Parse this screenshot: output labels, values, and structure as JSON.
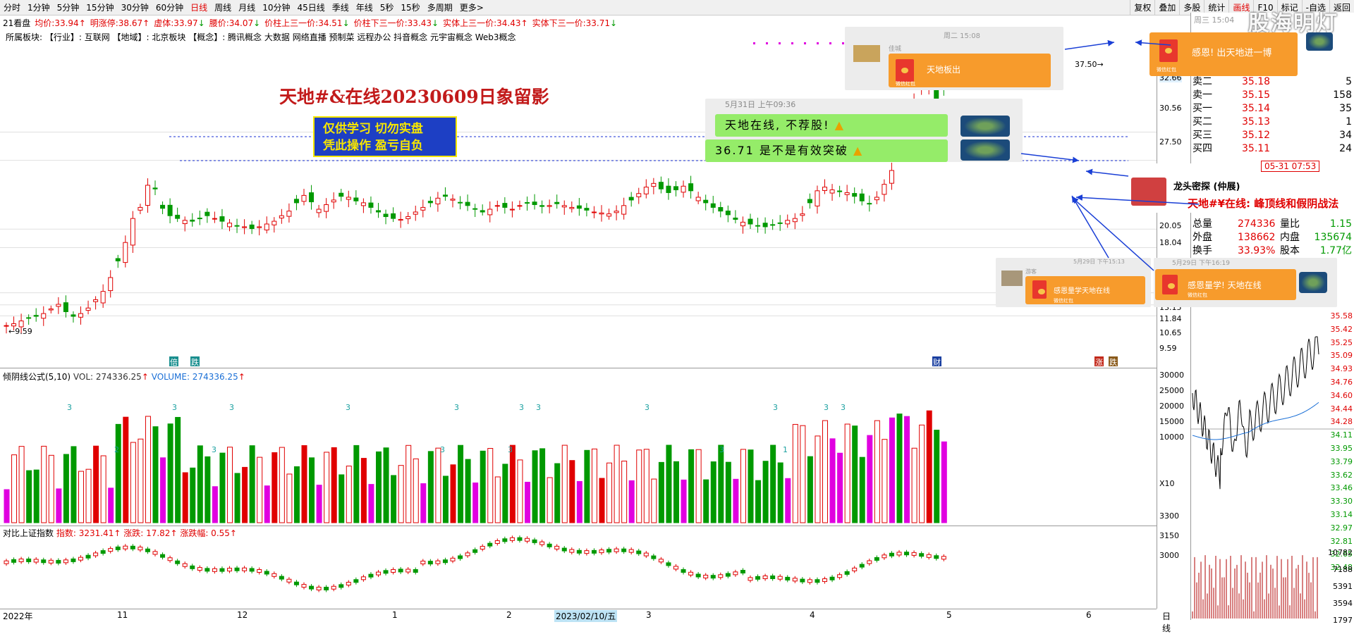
{
  "toolbar": {
    "left": [
      "分时",
      "1分钟",
      "5分钟",
      "15分钟",
      "30分钟",
      "60分钟",
      "日线",
      "周线",
      "月线",
      "10分钟",
      "45日线",
      "季线",
      "年线",
      "5秒",
      "15秒",
      "多周期",
      "更多>"
    ],
    "active": "日线",
    "right": [
      "复权",
      "叠加",
      "多股",
      "统计",
      "画线",
      "F10",
      "标记",
      "-自选",
      "返回"
    ],
    "right_active": "画线"
  },
  "quote": {
    "title": "21看盘",
    "items": [
      {
        "label": "均价:",
        "value": "33.94",
        "dir": "up"
      },
      {
        "label": "明涨停:",
        "value": "38.67",
        "dir": "up"
      },
      {
        "label": "虚体:",
        "value": "33.97",
        "dir": "dn"
      },
      {
        "label": "腰价:",
        "value": "34.07",
        "dir": "dn"
      },
      {
        "label": "价柱上三一价:",
        "value": "34.51",
        "dir": "dn"
      },
      {
        "label": "价柱下三一价:",
        "value": "33.43",
        "dir": "dn"
      },
      {
        "label": "实体上三一价:",
        "value": "34.43",
        "dir": "up"
      },
      {
        "label": "实体下三一价:",
        "value": "33.71",
        "dir": "dn"
      }
    ]
  },
  "concept": "所属板块:  【行业】: 互联网   【地域】: 北京板块   【概念】: 腾讯概念 大数据 网络直播 预制菜 远程办公 抖音概念 元宇宙概念 Web3概念",
  "headline": "天地#&在线20230609日象留影",
  "warning": [
    "仅供学习  切勿实盘",
    "凭此操作  盈亏自负"
  ],
  "watermark": "股海明灯",
  "indicators": {
    "volume_title": "倾阴线公式(5,10)",
    "vol_label": "VOL: 274336.25",
    "volume_label": "VOLUME: 274336.25",
    "index_title": "对比上证指数",
    "index_label": "指数: 3231.41",
    "change_label": "涨跌: 17.82",
    "pct_label": "涨跌幅: 0.55"
  },
  "price_marks": {
    "low": "9.59",
    "high": "37.50"
  },
  "dates": {
    "labels": [
      "2022年",
      "11",
      "12",
      "1",
      "2",
      "2023/02/10/五",
      "3",
      "4",
      "5",
      "6"
    ],
    "axis_label": "日线"
  },
  "main_scale": [
    "32.66",
    "30.56",
    "27.50",
    "20.05",
    "18.04",
    "13.15",
    "11.84",
    "10.65",
    "9.59"
  ],
  "vol_scale": [
    "30000",
    "25000",
    "20000",
    "15000",
    "10000",
    "X10"
  ],
  "idx_scale": [
    "3300",
    "3150",
    "3000"
  ],
  "orderbook": {
    "time": "周三 15:04",
    "rows": [
      {
        "n": "卖二",
        "p": "35.18",
        "q": "5"
      },
      {
        "n": "卖一",
        "p": "35.15",
        "q": "158"
      },
      {
        "n": "买一",
        "p": "35.14",
        "q": "35"
      },
      {
        "n": "买二",
        "p": "35.13",
        "q": "1"
      },
      {
        "n": "买三",
        "p": "35.12",
        "q": "34"
      },
      {
        "n": "买四",
        "p": "35.11",
        "q": "24"
      }
    ],
    "stats": [
      {
        "k": "总量",
        "v": "274336",
        "k2": "量比",
        "v2": "1.15"
      },
      {
        "k": "外盘",
        "v": "138662",
        "k2": "内盘",
        "v2": "135674"
      },
      {
        "k": "换手",
        "v": "33.93%",
        "k2": "股本",
        "v2": "1.77亿"
      }
    ],
    "tick_scale": [
      "35.58",
      "35.42",
      "35.25",
      "35.09",
      "34.93",
      "34.76",
      "34.60",
      "34.44",
      "34.28",
      "34.11",
      "33.95",
      "33.79",
      "33.62",
      "33.46",
      "33.30",
      "33.14",
      "32.97",
      "32.81",
      "32.65",
      "32.48",
      "10782",
      "7188",
      "5391",
      "3594",
      "1797"
    ]
  },
  "chats": {
    "c1_name": "佳城",
    "c1_time": "周二 15:08",
    "c1_packet": "天地板出",
    "c1_sub": "微信红包",
    "c2_time": "5月31日 上午09:36",
    "c2_msg1": "天地在线, 不荐股!",
    "c2_msg2": "36.71 是不是有效突破",
    "c3_packet": "感恩! 出天地进一博",
    "c3_sub": "微信红包",
    "c4_name": "龙头密探 (仲展)",
    "c4_date": "05-31 07:53",
    "c4_msg": "天地#¥在线: 峰顶线和假阴战法",
    "c5_time": "5月29日 下午15:13",
    "c5_name": "游客",
    "c5_packet": "感恩量学天地在线",
    "c5_sub": "微信红包",
    "c6_time": "5月29日 下午16:19",
    "c6_packet": "感恩量学! 天地在线",
    "c6_sub": "微信红包"
  },
  "chart_data": {
    "type": "candlestick",
    "title": "",
    "ylim": [
      9,
      38
    ],
    "closes": [
      9.6,
      9.8,
      10.1,
      10.4,
      10.6,
      10.9,
      11.4,
      11.9,
      11.1,
      10.6,
      10.9,
      11.5,
      12.4,
      13.3,
      14.8,
      16.6,
      18.6,
      21.2,
      22.4,
      24.8,
      24.4,
      22.3,
      21.5,
      21.2,
      21.0,
      20.9,
      21.2,
      21.5,
      21.2,
      20.9,
      20.7,
      20.4,
      20.3,
      20.1,
      20.3,
      20.6,
      20.9,
      21.5,
      22.0,
      22.9,
      23.7,
      23.0,
      22.2,
      22.7,
      23.2,
      23.6,
      23.5,
      23.1,
      22.9,
      22.4,
      21.9,
      21.4,
      21.2,
      21.1,
      21.4,
      21.9,
      22.4,
      22.9,
      23.4,
      23.6,
      23.3,
      22.9,
      22.6,
      22.2,
      21.9,
      22.2,
      22.6,
      22.4,
      22.2,
      22.6,
      22.9,
      22.7,
      22.5,
      22.6,
      22.8,
      22.6,
      22.4,
      22.3,
      22.1,
      21.9,
      21.8,
      21.7,
      22.0,
      22.6,
      23.2,
      23.9,
      24.6,
      25.0,
      24.4,
      24.0,
      24.3,
      24.7,
      24.2,
      23.5,
      22.9,
      22.4,
      22.0,
      21.6,
      21.1,
      20.8,
      20.6,
      20.4,
      20.3,
      20.5,
      20.7,
      21.0,
      21.2,
      21.7,
      22.9,
      24.2,
      24.6,
      24.3,
      24.1,
      24.0,
      23.6,
      23.1,
      22.8,
      23.5,
      24.9,
      26.4,
      28.4,
      30.8,
      33.9,
      35.6,
      36.2,
      34.2,
      35.3
    ]
  }
}
